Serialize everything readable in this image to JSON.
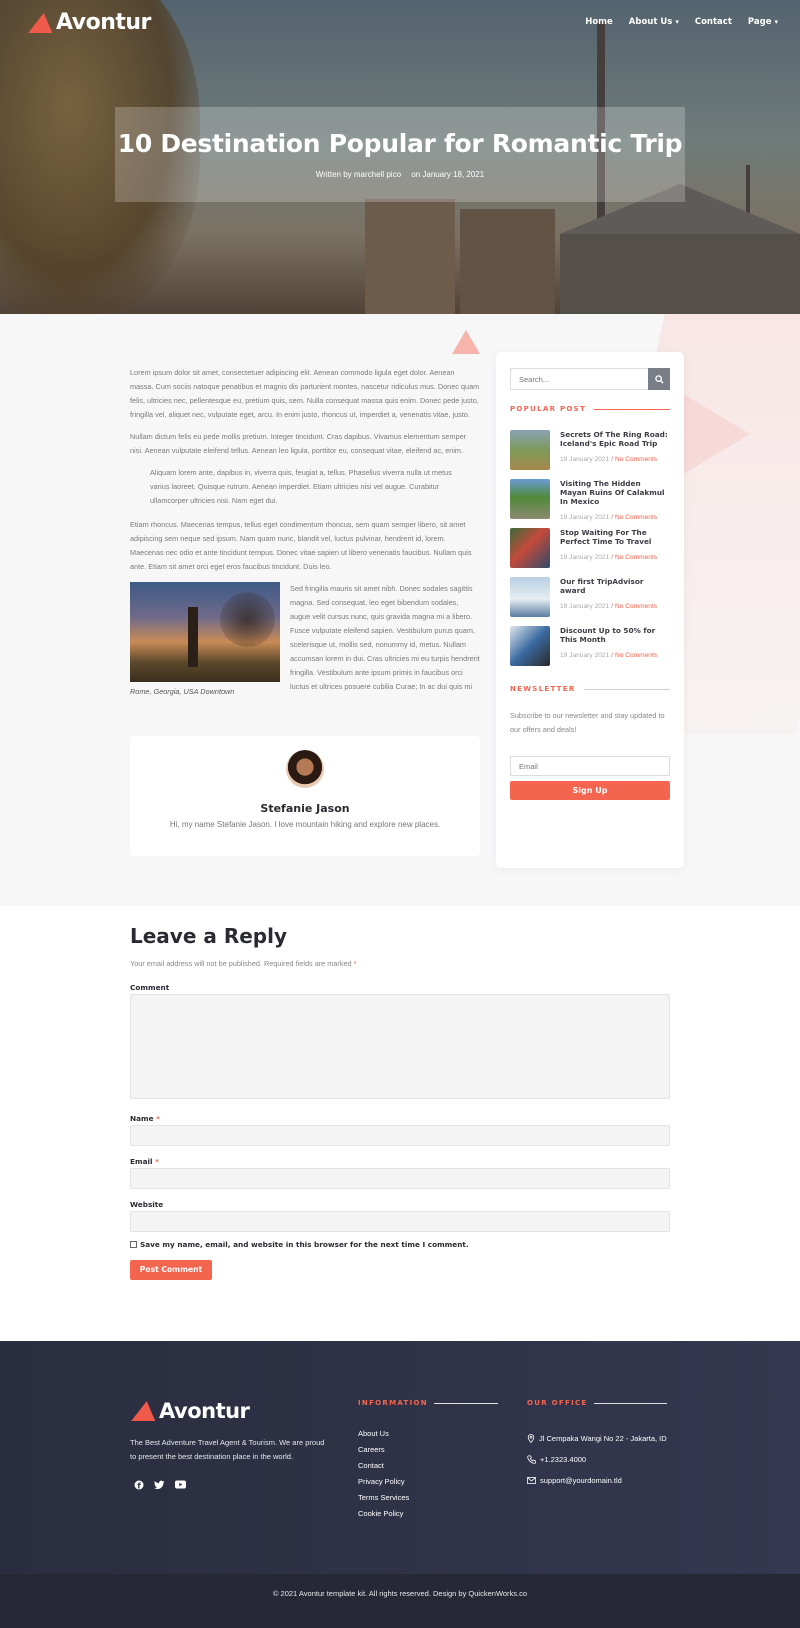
{
  "site": {
    "logo": "Avontur"
  },
  "nav": {
    "items": [
      {
        "label": "Home",
        "dropdown": false
      },
      {
        "label": "About Us",
        "dropdown": true
      },
      {
        "label": "Contact",
        "dropdown": false
      },
      {
        "label": "Page",
        "dropdown": true
      }
    ]
  },
  "hero": {
    "title": "10 Destination Popular for Romantic Trip",
    "author": "Written by marchell pico",
    "date": "on January 18, 2021"
  },
  "article": {
    "p1": "Lorem ipsum dolor sit amet, consectetuer adipiscing elit. Aenean commodo ligula eget dolor. Aenean massa. Cum sociis natoque penatibus et magnis dis parturient montes, nascetur ridiculus mus. Donec quam felis, ultricies nec, pellentesque eu, pretium quis, sem. Nulla consequat massa quis enim. Donec pede justo, fringilla vel, aliquet nec, vulputate eget, arcu. In enim justo, rhoncus ut, imperdiet a, venenatis vitae, justo.",
    "p2": "Nullam dictum felis eu pede mollis pretium. Integer tincidunt. Cras dapibus. Vivamus elementum semper nisi. Aenean vulputate eleifend tellus. Aenean leo ligula, porttitor eu, consequat vitae, eleifend ac, enim.",
    "quote": "Aliquam lorem ante, dapibus in, viverra quis, feugiat a, tellus. Phasellus viverra nulla ut metus varius laoreet. Quisque rutrum. Aenean imperdiet. Etiam ultricies nisi vel augue. Curabitur ullamcorper ultricies nisi. Nam eget dui.",
    "p3": "Etiam rhoncus. Maecenas tempus, tellus eget condimentum rhoncus, sem quam semper libero, sit amet adipiscing sem neque sed ipsum. Nam quam nunc, blandit vel, luctus pulvinar, hendrerit id, lorem. Maecenas nec odio et ante tincidunt tempus. Donec vitae sapien ut libero venenatis faucibus. Nullam quis ante. Etiam sit amet orci eget eros faucibus tincidunt. Duis leo.",
    "figure_text": "Sed fringilla mauris sit amet nibh. Donec sodales sagittis magna. Sed consequat, leo eget bibendum sodales, augue velit cursus nunc, quis gravida magna mi a libero. Fusce vulputate eleifend sapien. Vestibulum purus quam, scelerisque ut, mollis sed, nonummy id, metus. Nullam accumsan lorem in dui. Cras ultricies mi eu turpis hendrerit fringilla. Vestibulum ante ipsum primis in faucibus orci luctus et ultrices posuere cubilia Curae; In ac dui quis mi",
    "caption": "Rome, Georgia, USA Downtown"
  },
  "author_card": {
    "name": "Stefanie Jason",
    "bio": "Hi, my name Stefanie Jason. I love mountain hiking and explore new places."
  },
  "sidebar": {
    "search_placeholder": "Search...",
    "popular_heading": "POPULAR POST",
    "posts": [
      {
        "title": "Secrets Of The Ring Road: Iceland's Epic Road Trip",
        "date": "19 January 2021",
        "comments": "No Comments"
      },
      {
        "title": "Visiting The Hidden Mayan Ruins Of Calakmul In Mexico",
        "date": "19 January 2021",
        "comments": "No Comments"
      },
      {
        "title": "Stop Waiting For The Perfect Time To Travel",
        "date": "19 January 2021",
        "comments": "No Comments"
      },
      {
        "title": "Our first TripAdvisor award",
        "date": "19 January 2021",
        "comments": "No Comments"
      },
      {
        "title": "Discount Up to 50% for This Month",
        "date": "19 January 2021",
        "comments": "No Comments"
      }
    ],
    "date_separator": "/",
    "newsletter_heading": "NEWSLETTER",
    "newsletter_text": "Subscribe to our newsletter and stay updated to our offers and deals!",
    "email_placeholder": "Email",
    "signup_label": "Sign Up"
  },
  "reply": {
    "heading": "Leave a Reply",
    "note": "Your email address will not be published. Required fields are marked",
    "required_mark": "*",
    "comment_label": "Comment",
    "name_label": "Name",
    "email_label": "Email",
    "website_label": "Website",
    "save_label": "Save my name, email, and website in this browser for the next time I comment.",
    "submit_label": "Post Comment"
  },
  "footer": {
    "logo": "Avontur",
    "tagline": "The Best Adventure Travel Agent & Tourism. We are proud to present the best destination place in the world.",
    "info_heading": "INFORMATION",
    "links": [
      "About Us",
      "Careers",
      "Contact",
      "Privacy Policy",
      "Terms Services",
      "Cookie Policy"
    ],
    "office_heading": "OUR OFFICE",
    "address": "Jl Cempaka Wangi No 22 - Jakarta, ID",
    "phone": "+1.2323.4000",
    "email": "support@yourdomain.tld",
    "copyright": "© 2021 Avontur template kit. All rights reserved. Design by QuickenWorks.co"
  },
  "colors": {
    "accent": "#f4654f",
    "footer_bg": "#2f3246",
    "heading": "#2a2a33"
  }
}
